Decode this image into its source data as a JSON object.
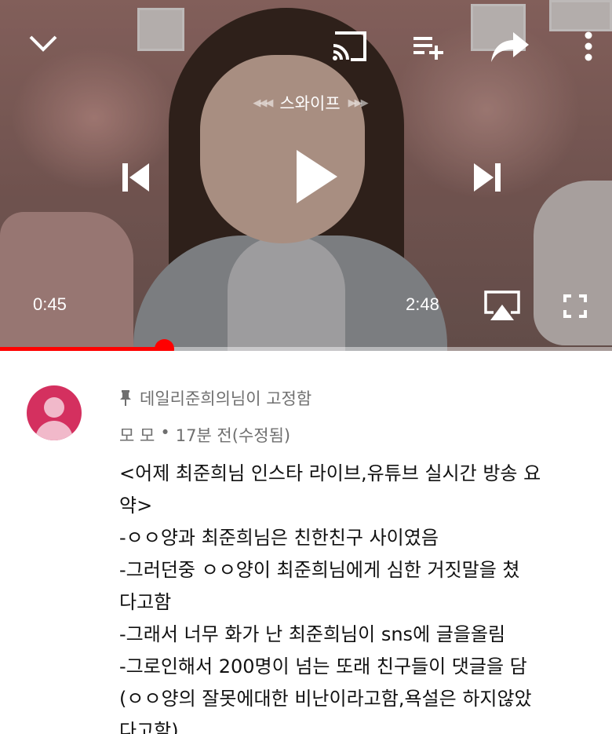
{
  "player": {
    "swipe_label": "스와이프",
    "swipe_left_arrows": "◀◀◀",
    "swipe_right_arrows": "▶▶▶",
    "elapsed": "0:45",
    "duration": "2:48",
    "progress_fraction": 0.268,
    "icons": {
      "collapse": "chevron-down-icon",
      "cast": "cast-icon",
      "add_to_playlist": "playlist-add-icon",
      "share": "share-icon",
      "more": "more-vertical-icon",
      "previous": "skip-previous-icon",
      "play": "play-icon",
      "next": "skip-next-icon",
      "airplay": "airplay-icon",
      "fullscreen": "fullscreen-icon"
    },
    "accent_color": "#ff0000"
  },
  "comment": {
    "pinned_label": "데일리준희의님이 고정함",
    "author": "모 모",
    "separator": "•",
    "timestamp": "17분 전(수정됨)",
    "avatar_color": "#d4305f",
    "lines": [
      "<어제 최준희님 인스타 라이브,유튜브 실시간 방송 요",
      "약>",
      "-ㅇㅇ양과 최준희님은 친한친구 사이였음",
      "-그러던중 ㅇㅇ양이 최준희님에게 심한 거짓말을 쳤",
      "다고함",
      "-그래서 너무 화가 난 최준희님이 sns에 글을올림",
      "-그로인해서 200명이 넘는 또래 친구들이 댓글을 담",
      "(ㅇㅇ양의 잘못에대한 비난이라고함,욕설은 하지않았",
      "다고함)"
    ]
  }
}
